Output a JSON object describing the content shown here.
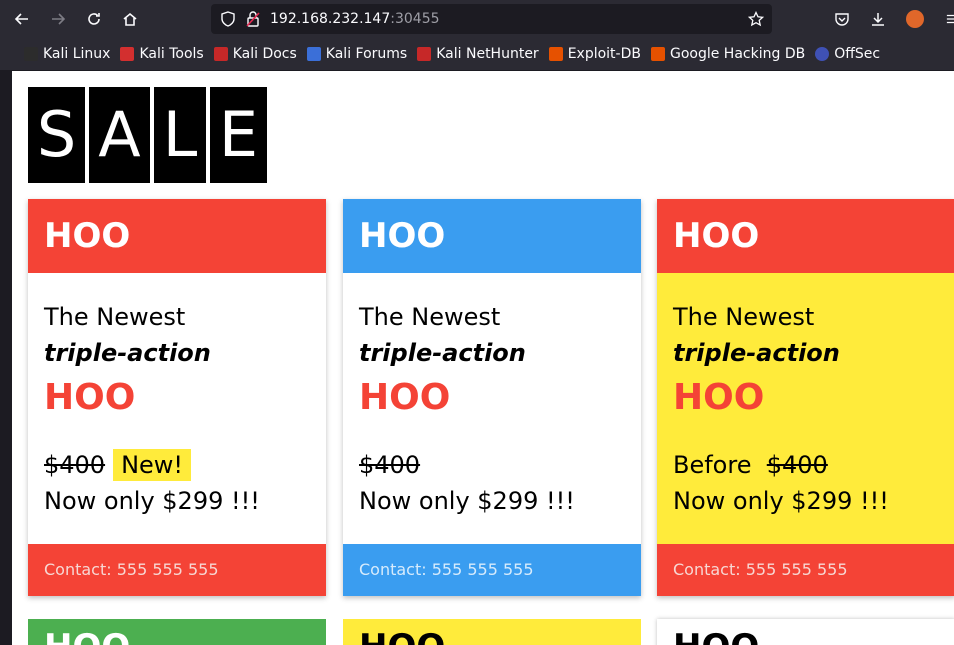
{
  "browser": {
    "url_host": "192.168.232.147",
    "url_port": ":30455",
    "bookmarks": [
      {
        "label": "Kali Linux",
        "color": "#2c2c2c"
      },
      {
        "label": "Kali Tools",
        "color": "#d32f2f"
      },
      {
        "label": "Kali Docs",
        "color": "#c62828"
      },
      {
        "label": "Kali Forums",
        "color": "#3b6fd8"
      },
      {
        "label": "Kali NetHunter",
        "color": "#c62828"
      },
      {
        "label": "Exploit-DB",
        "color": "#e65100"
      },
      {
        "label": "Google Hacking DB",
        "color": "#e65100"
      },
      {
        "label": "OffSec",
        "color": "#3f51b5"
      }
    ]
  },
  "page": {
    "logo_letters": [
      "S",
      "A",
      "L",
      "E"
    ],
    "cards": [
      {
        "title": "HOO",
        "line1": "The Newest",
        "line2": "triple-action",
        "line3": "HOO",
        "price_prefix": "",
        "old_price": "$400",
        "badge": "New!",
        "now": "Now only $299 !!!",
        "contact": "Contact: 555 555 555",
        "header_color": "#f44336",
        "body_color": "#ffffff",
        "footer_color": "#f44336"
      },
      {
        "title": "HOO",
        "line1": "The Newest",
        "line2": "triple-action",
        "line3": "HOO",
        "price_prefix": "",
        "old_price": "$400",
        "badge": "",
        "now": "Now only $299 !!!",
        "contact": "Contact: 555 555 555",
        "header_color": "#3a9df0",
        "body_color": "#ffffff",
        "footer_color": "#3a9df0"
      },
      {
        "title": "HOO",
        "line1": "The Newest",
        "line2": "triple-action",
        "line3": "HOO",
        "price_prefix": "Before ",
        "old_price": "$400",
        "badge": "",
        "now": "Now only $299 !!!",
        "contact": "Contact: 555 555 555",
        "header_color": "#f44336",
        "body_color": "#ffeb3b",
        "footer_color": "#f44336"
      }
    ],
    "partial_cards": [
      {
        "title": "HOO",
        "color": "#4caf50",
        "text_color": "#ffffff"
      },
      {
        "title": "HOO",
        "color": "#ffeb3b",
        "text_color": "#000000"
      },
      {
        "title": "HOO",
        "color": "#ffffff",
        "text_color": "#000000"
      }
    ]
  }
}
